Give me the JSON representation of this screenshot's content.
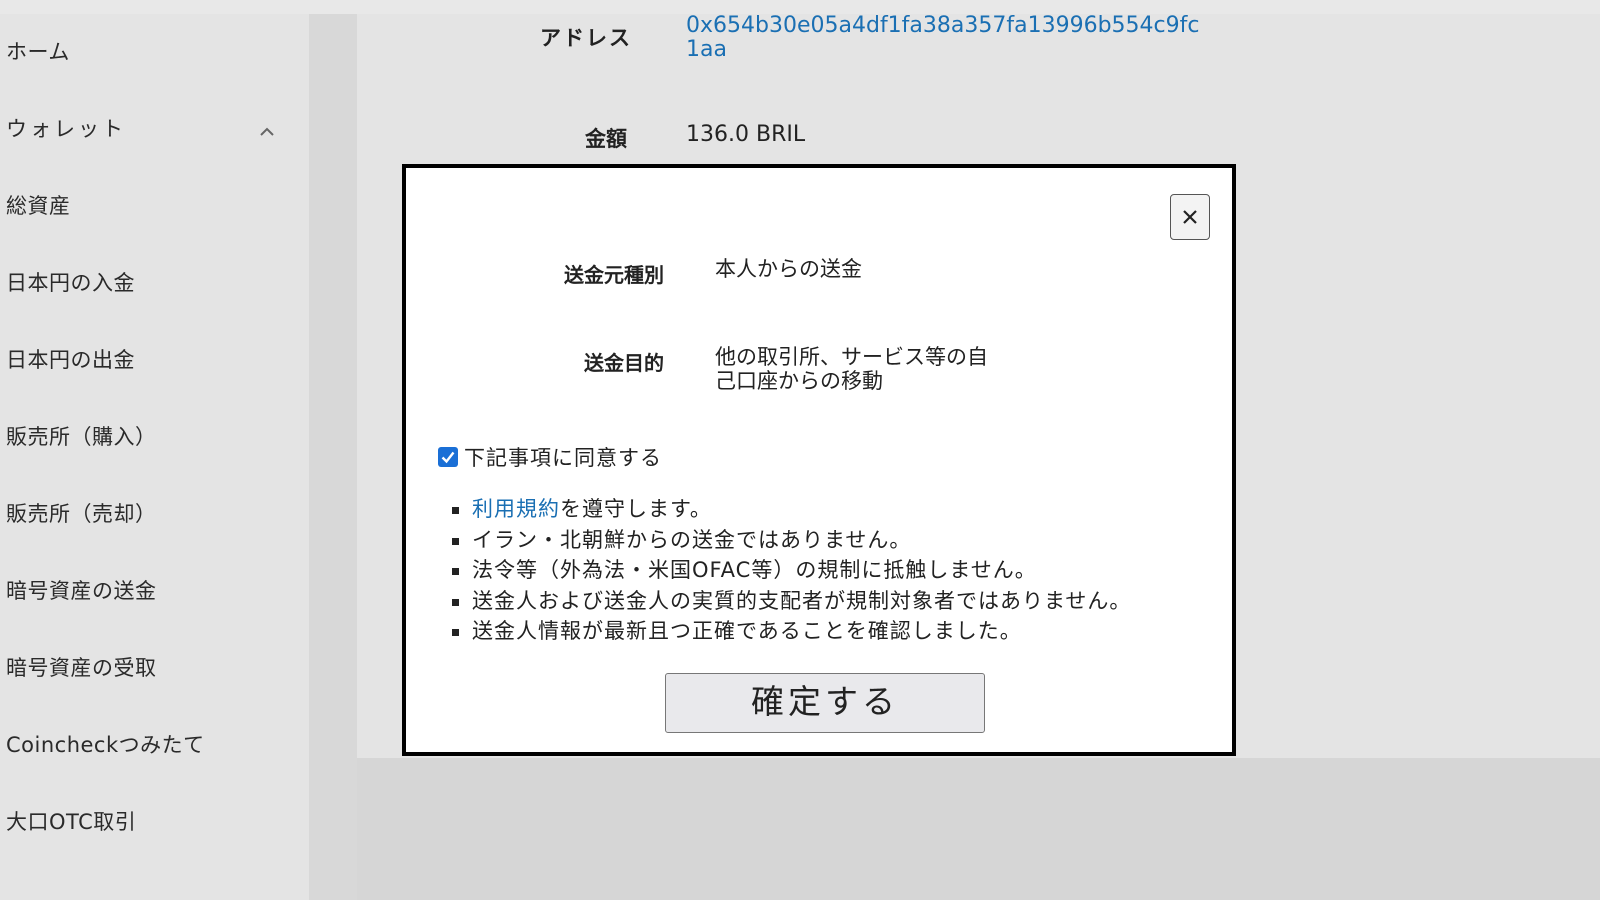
{
  "sidebar": {
    "items": [
      {
        "label": "ホーム"
      },
      {
        "label": "ウォレット"
      },
      {
        "label": "総資産"
      },
      {
        "label": "日本円の入金"
      },
      {
        "label": "日本円の出金"
      },
      {
        "label": "販売所（購入）"
      },
      {
        "label": "販売所（売却）"
      },
      {
        "label": "暗号資産の送金"
      },
      {
        "label": "暗号資産の受取"
      },
      {
        "label": "Coincheckつみたて"
      },
      {
        "label": "大口OTC取引"
      }
    ]
  },
  "details": {
    "address_label": "アドレス",
    "address_value": "0x654b30e05a4df1fa38a357fa13996b554c9fc1aa",
    "amount_label": "金額",
    "amount_value": "136.0 BRIL"
  },
  "modal": {
    "close_symbol": "×",
    "source_type_label": "送金元種別",
    "source_type_value": "本人からの送金",
    "purpose_label": "送金目的",
    "purpose_value_line1": "他の取引所、サービス等の自",
    "purpose_value_line2": "己口座からの移動",
    "agree_label": "下記事項に同意する",
    "agree_checked": true,
    "terms": {
      "item1_link": "利用規約",
      "item1_rest": "を遵守します。",
      "item2": "イラン・北朝鮮からの送金ではありません。",
      "item3": "法令等（外為法・米国OFAC等）の規制に抵触しません。",
      "item4": "送金人および送金人の実質的支配者が規制対象者ではありません。",
      "item5": "送金人情報が最新且つ正確であることを確認しました。"
    },
    "confirm_label": "確定する"
  },
  "colors": {
    "link": "#1a6fb3",
    "checkbox": "#1a6fd6",
    "overlay": "#d6d6d6",
    "modal_border": "#000000"
  }
}
